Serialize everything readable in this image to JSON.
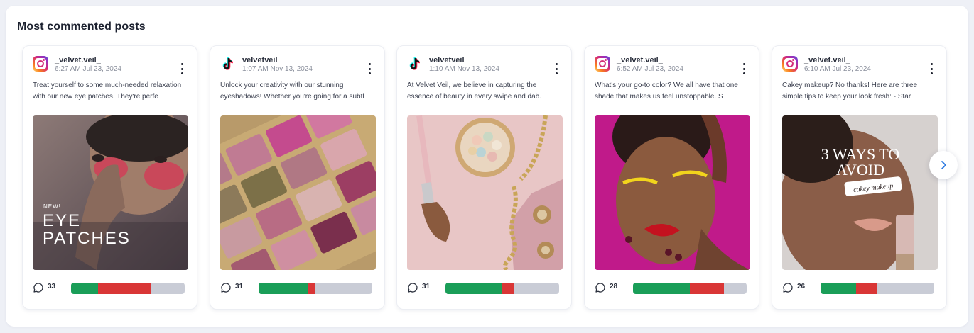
{
  "section": {
    "title": "Most commented posts"
  },
  "posts": [
    {
      "platform": "instagram-icon",
      "handle": "_velvet.veil_",
      "time": "6:27 AM Jul 23, 2024",
      "caption": "Treat yourself to some much-needed relaxation with our new eye patches. They're perfe",
      "image_text": {
        "line1": "NEW!",
        "line2": "EYE",
        "line3": "PATCHES"
      },
      "comments": "33",
      "sentiment": {
        "positive": 0.24,
        "negative": 0.46
      }
    },
    {
      "platform": "tiktok-icon",
      "handle": "velvetveil",
      "time": "1:07 AM Nov 13, 2024",
      "caption": "Unlock your creativity with our stunning eyeshadows! Whether you're going for a subtl",
      "comments": "31",
      "sentiment": {
        "positive": 0.43,
        "negative": 0.07
      }
    },
    {
      "platform": "tiktok-icon",
      "handle": "velvetveil",
      "time": "1:10 AM Nov 13, 2024",
      "caption": "At Velvet Veil, we believe in capturing the essence of beauty in every swipe and dab.",
      "comments": "31",
      "sentiment": {
        "positive": 0.5,
        "negative": 0.1
      }
    },
    {
      "platform": "instagram-icon",
      "handle": "_velvet.veil_",
      "time": "6:52 AM Jul 23, 2024",
      "caption": "What's your go-to color? We all have that one shade that makes us feel unstoppable. S",
      "comments": "28",
      "sentiment": {
        "positive": 0.5,
        "negative": 0.3
      }
    },
    {
      "platform": "instagram-icon",
      "handle": "_velvet.veil_",
      "time": "6:10 AM Jul 23, 2024",
      "caption": "Cakey makeup? No thanks! Here are three simple tips to keep your look fresh: - Star",
      "image_text": {
        "line1": "3 WAYS TO",
        "line2": "AVOID",
        "line3": "cakey makeup"
      },
      "comments": "26",
      "sentiment": {
        "positive": 0.31,
        "negative": 0.19
      }
    }
  ],
  "colors": {
    "positive": "#1a9e58",
    "negative": "#d93636",
    "neutral": "#c9ccd6"
  },
  "controls": {
    "next": "chevron-right-icon"
  }
}
